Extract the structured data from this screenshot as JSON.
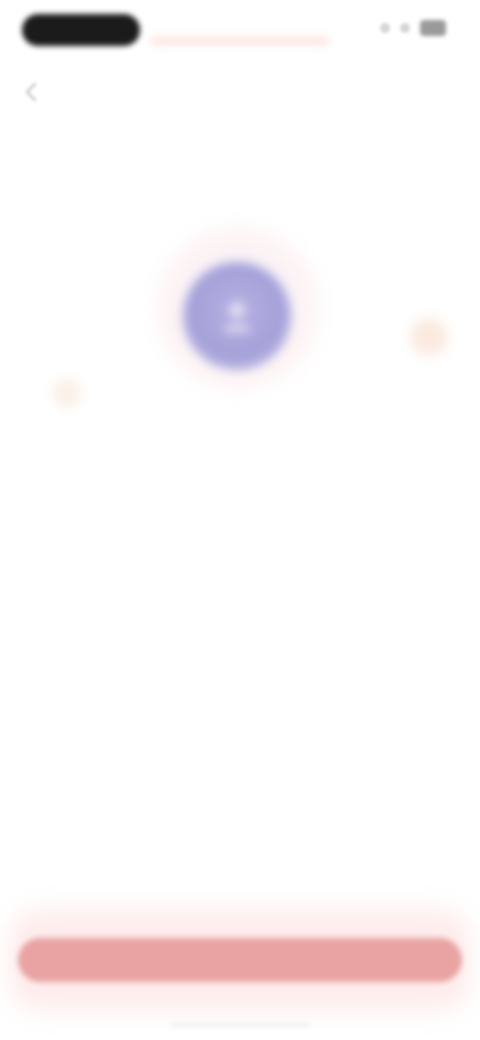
{
  "status_bar": {
    "time": "",
    "icons": [
      "signal-icon",
      "wifi-icon",
      "battery-icon"
    ]
  },
  "nav": {
    "back_icon": "chevron-left-icon"
  },
  "hero": {
    "icon": "user-icon",
    "accent_color": "#a5a1d8"
  },
  "content": {
    "headline": "",
    "sub_link": ""
  },
  "footer": {
    "primary_button_label": "",
    "button_color": "#e9a3a3"
  }
}
